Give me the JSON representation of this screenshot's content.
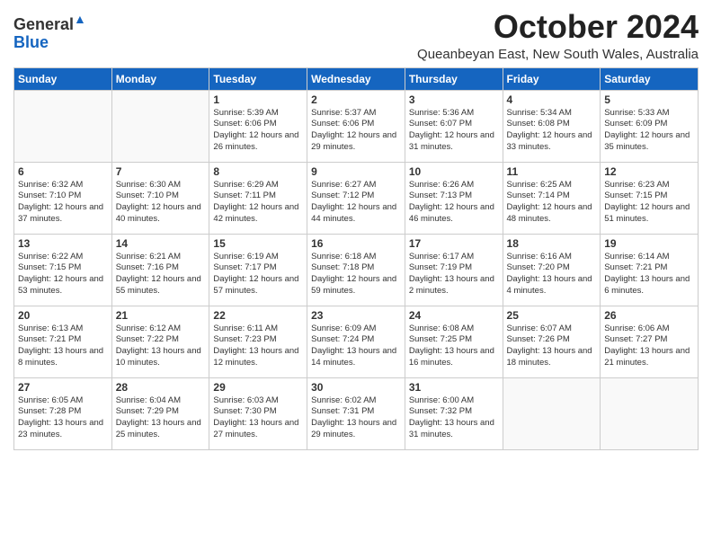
{
  "header": {
    "logo_general": "General",
    "logo_blue": "Blue",
    "month_title": "October 2024",
    "subtitle": "Queanbeyan East, New South Wales, Australia"
  },
  "days_of_week": [
    "Sunday",
    "Monday",
    "Tuesday",
    "Wednesday",
    "Thursday",
    "Friday",
    "Saturday"
  ],
  "weeks": [
    [
      {
        "day": "",
        "info": ""
      },
      {
        "day": "",
        "info": ""
      },
      {
        "day": "1",
        "info": "Sunrise: 5:39 AM\nSunset: 6:06 PM\nDaylight: 12 hours\nand 26 minutes."
      },
      {
        "day": "2",
        "info": "Sunrise: 5:37 AM\nSunset: 6:06 PM\nDaylight: 12 hours\nand 29 minutes."
      },
      {
        "day": "3",
        "info": "Sunrise: 5:36 AM\nSunset: 6:07 PM\nDaylight: 12 hours\nand 31 minutes."
      },
      {
        "day": "4",
        "info": "Sunrise: 5:34 AM\nSunset: 6:08 PM\nDaylight: 12 hours\nand 33 minutes."
      },
      {
        "day": "5",
        "info": "Sunrise: 5:33 AM\nSunset: 6:09 PM\nDaylight: 12 hours\nand 35 minutes."
      }
    ],
    [
      {
        "day": "6",
        "info": "Sunrise: 6:32 AM\nSunset: 7:10 PM\nDaylight: 12 hours\nand 37 minutes."
      },
      {
        "day": "7",
        "info": "Sunrise: 6:30 AM\nSunset: 7:10 PM\nDaylight: 12 hours\nand 40 minutes."
      },
      {
        "day": "8",
        "info": "Sunrise: 6:29 AM\nSunset: 7:11 PM\nDaylight: 12 hours\nand 42 minutes."
      },
      {
        "day": "9",
        "info": "Sunrise: 6:27 AM\nSunset: 7:12 PM\nDaylight: 12 hours\nand 44 minutes."
      },
      {
        "day": "10",
        "info": "Sunrise: 6:26 AM\nSunset: 7:13 PM\nDaylight: 12 hours\nand 46 minutes."
      },
      {
        "day": "11",
        "info": "Sunrise: 6:25 AM\nSunset: 7:14 PM\nDaylight: 12 hours\nand 48 minutes."
      },
      {
        "day": "12",
        "info": "Sunrise: 6:23 AM\nSunset: 7:15 PM\nDaylight: 12 hours\nand 51 minutes."
      }
    ],
    [
      {
        "day": "13",
        "info": "Sunrise: 6:22 AM\nSunset: 7:15 PM\nDaylight: 12 hours\nand 53 minutes."
      },
      {
        "day": "14",
        "info": "Sunrise: 6:21 AM\nSunset: 7:16 PM\nDaylight: 12 hours\nand 55 minutes."
      },
      {
        "day": "15",
        "info": "Sunrise: 6:19 AM\nSunset: 7:17 PM\nDaylight: 12 hours\nand 57 minutes."
      },
      {
        "day": "16",
        "info": "Sunrise: 6:18 AM\nSunset: 7:18 PM\nDaylight: 12 hours\nand 59 minutes."
      },
      {
        "day": "17",
        "info": "Sunrise: 6:17 AM\nSunset: 7:19 PM\nDaylight: 13 hours\nand 2 minutes."
      },
      {
        "day": "18",
        "info": "Sunrise: 6:16 AM\nSunset: 7:20 PM\nDaylight: 13 hours\nand 4 minutes."
      },
      {
        "day": "19",
        "info": "Sunrise: 6:14 AM\nSunset: 7:21 PM\nDaylight: 13 hours\nand 6 minutes."
      }
    ],
    [
      {
        "day": "20",
        "info": "Sunrise: 6:13 AM\nSunset: 7:21 PM\nDaylight: 13 hours\nand 8 minutes."
      },
      {
        "day": "21",
        "info": "Sunrise: 6:12 AM\nSunset: 7:22 PM\nDaylight: 13 hours\nand 10 minutes."
      },
      {
        "day": "22",
        "info": "Sunrise: 6:11 AM\nSunset: 7:23 PM\nDaylight: 13 hours\nand 12 minutes."
      },
      {
        "day": "23",
        "info": "Sunrise: 6:09 AM\nSunset: 7:24 PM\nDaylight: 13 hours\nand 14 minutes."
      },
      {
        "day": "24",
        "info": "Sunrise: 6:08 AM\nSunset: 7:25 PM\nDaylight: 13 hours\nand 16 minutes."
      },
      {
        "day": "25",
        "info": "Sunrise: 6:07 AM\nSunset: 7:26 PM\nDaylight: 13 hours\nand 18 minutes."
      },
      {
        "day": "26",
        "info": "Sunrise: 6:06 AM\nSunset: 7:27 PM\nDaylight: 13 hours\nand 21 minutes."
      }
    ],
    [
      {
        "day": "27",
        "info": "Sunrise: 6:05 AM\nSunset: 7:28 PM\nDaylight: 13 hours\nand 23 minutes."
      },
      {
        "day": "28",
        "info": "Sunrise: 6:04 AM\nSunset: 7:29 PM\nDaylight: 13 hours\nand 25 minutes."
      },
      {
        "day": "29",
        "info": "Sunrise: 6:03 AM\nSunset: 7:30 PM\nDaylight: 13 hours\nand 27 minutes."
      },
      {
        "day": "30",
        "info": "Sunrise: 6:02 AM\nSunset: 7:31 PM\nDaylight: 13 hours\nand 29 minutes."
      },
      {
        "day": "31",
        "info": "Sunrise: 6:00 AM\nSunset: 7:32 PM\nDaylight: 13 hours\nand 31 minutes."
      },
      {
        "day": "",
        "info": ""
      },
      {
        "day": "",
        "info": ""
      }
    ]
  ]
}
